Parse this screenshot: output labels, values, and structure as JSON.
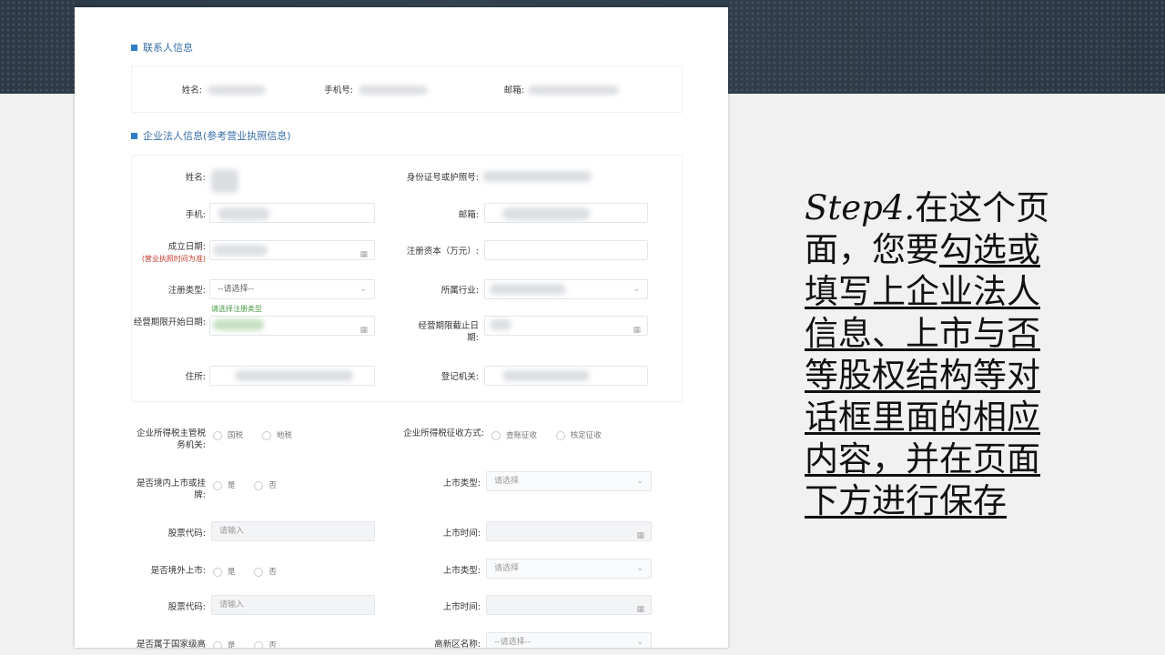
{
  "slide_text": {
    "step_label": "Step4.",
    "intro": "在这个页面，您要",
    "instruction": "勾选或填写上企业法人信息、上市与否等股权结构等对话框里面的相应内容，并在页面下方进行保存"
  },
  "contact_section": {
    "title": "联系人信息",
    "name_label": "姓名:",
    "phone_label": "手机号:",
    "email_label": "邮箱:"
  },
  "corp_section": {
    "title": "企业法人信息(参考营业执照信息)",
    "name_label": "姓名:",
    "id_label": "身份证号或护照号:",
    "mobile_label": "手机:",
    "email_label": "邮箱:",
    "founded_label": "成立日期:",
    "founded_sub": "(营业执照时间为准)",
    "capital_label": "注册资本（万元）:",
    "reg_type_label": "注册类型:",
    "reg_type_value": "--请选择--",
    "reg_type_hint": "请选择注册类型",
    "industry_label": "所属行业:",
    "op_start_label": "经营期限开始日期:",
    "op_end_label": "经营期限截止日期:",
    "address_label": "住所:",
    "registrar_label": "登记机关:"
  },
  "tax_section": {
    "tax_authority_label": "企业所得税主管税务机关:",
    "tax_authority_options": [
      "国税",
      "地税"
    ],
    "tax_method_label": "企业所得税征收方式:",
    "tax_method_options": [
      "查账征收",
      "核定征收"
    ],
    "listed_domestic_label": "是否境内上市或挂牌:",
    "yes": "是",
    "no": "否",
    "listing_type_label": "上市类型:",
    "select_placeholder": "请选择",
    "stock_code_label": "股票代码:",
    "input_placeholder": "请输入",
    "listing_time_label": "上市时间:",
    "listed_overseas_label": "是否境外上市:",
    "national_hightech_label": "是否属于国家级高",
    "hightech_zone_label": "高新区名称:",
    "hightech_zone_placeholder": "--请选择--"
  },
  "icons": {
    "calendar": "calendar-icon",
    "chevron": "chevron-down-icon"
  }
}
